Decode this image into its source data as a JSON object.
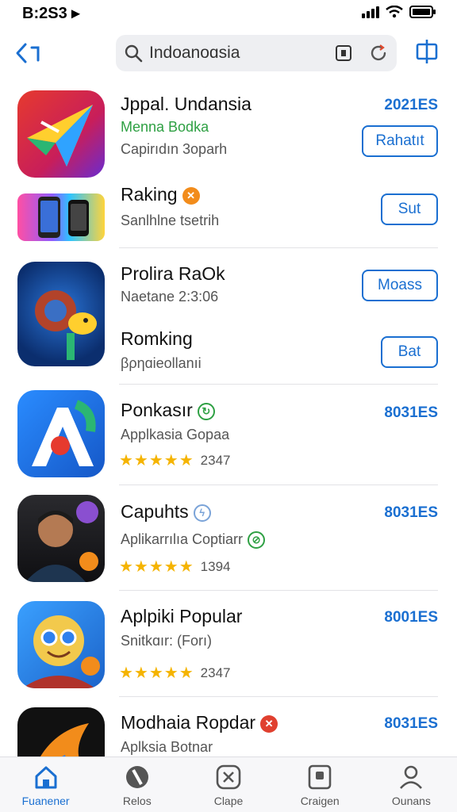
{
  "status_bar": {
    "time": "B:2S3 ▸"
  },
  "search": {
    "query": "Indoanoɑsia"
  },
  "apps": [
    {
      "name": "Jppal. Undansia",
      "subtitle": "Menna Bodka",
      "subtitle2": "Capirıdın 3oparh",
      "action_text": "2021ES",
      "button_label": "Rahatıt"
    },
    {
      "name": "Raking",
      "subtitle": "Sanlhlne tsetrih",
      "button_label": "Sut"
    },
    {
      "name": "Prolira RaOk",
      "subtitle": "Naetane 2:3:06",
      "button_label": "Moass"
    },
    {
      "name": "Romking",
      "subtitle": "βρηɑieollanıi",
      "button_label": "Bat"
    },
    {
      "name": "Ponkasır",
      "subtitle": "Applkasia Gopaa",
      "rating": "★★★★★",
      "count": "2347",
      "action_text": "8031ES"
    },
    {
      "name": "Capuhts",
      "subtitle": "Aplikarrılıa Coptiarr",
      "rating": "★★★★★",
      "count": "1394",
      "action_text": "8031ES"
    },
    {
      "name": "Aplpiki Popular",
      "subtitle": "Snitkɑır: (Forı)",
      "rating": "★★★★★",
      "count": "2347",
      "action_text": "8001ES"
    },
    {
      "name": "Modhaia Ropdar",
      "subtitle": "Aplksia Botnar",
      "action_text": "8031ES"
    }
  ],
  "tabs": [
    {
      "label": "Fuanener",
      "icon": "home-icon"
    },
    {
      "label": "Relos",
      "icon": "compass-icon"
    },
    {
      "label": "Clape",
      "icon": "gamepad-icon"
    },
    {
      "label": "Craigen",
      "icon": "apps-icon"
    },
    {
      "label": "Ounans",
      "icon": "person-icon"
    }
  ],
  "colors": {
    "accent": "#1a6fd1",
    "star": "#f5b400",
    "green": "#2ea043"
  }
}
